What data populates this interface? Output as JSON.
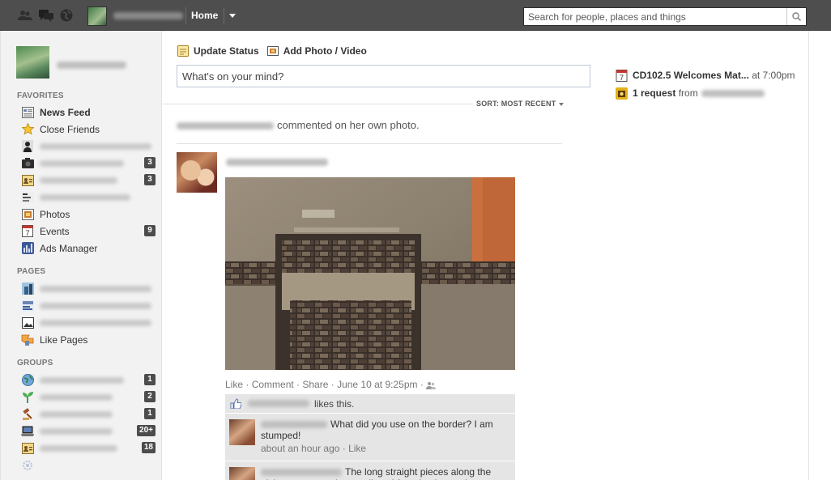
{
  "topbar": {
    "home_label": "Home",
    "search_placeholder": "Search for people, places and things",
    "icons": [
      "friend-requests-icon",
      "messages-icon",
      "notifications-globe-icon"
    ]
  },
  "sidebar": {
    "favorites_heading": "FAVORITES",
    "favorites": [
      {
        "label": "News Feed",
        "icon": "news-feed-icon",
        "bold": true
      },
      {
        "label": "Close Friends",
        "icon": "star-icon"
      },
      {
        "label": "",
        "icon": "person-photo-icon"
      },
      {
        "label": "",
        "icon": "camera-icon",
        "count": "3"
      },
      {
        "label": "",
        "icon": "contact-card-icon",
        "count": "3"
      },
      {
        "label": "",
        "icon": "page-thumb-icon"
      },
      {
        "label": "Photos",
        "icon": "photos-icon"
      },
      {
        "label": "Events",
        "icon": "calendar-icon",
        "count": "9"
      },
      {
        "label": "Ads Manager",
        "icon": "ads-manager-icon"
      }
    ],
    "pages_heading": "PAGES",
    "pages": [
      {
        "label": "",
        "icon": "page-building-icon"
      },
      {
        "label": "",
        "icon": "page-flag-icon"
      },
      {
        "label": "",
        "icon": "page-picture-icon"
      },
      {
        "label": "Like Pages",
        "icon": "like-pages-icon"
      }
    ],
    "groups_heading": "GROUPS",
    "groups": [
      {
        "label": "",
        "icon": "globe-icon",
        "count": "1"
      },
      {
        "label": "",
        "icon": "plant-icon",
        "count": "2"
      },
      {
        "label": "",
        "icon": "gavel-icon",
        "count": "1"
      },
      {
        "label": "",
        "icon": "laptop-icon",
        "count": "20+"
      },
      {
        "label": "",
        "icon": "group-card-icon",
        "count": "18"
      }
    ]
  },
  "composer": {
    "update_status": "Update Status",
    "add_photo": "Add Photo / Video",
    "placeholder": "What's on your mind?"
  },
  "feed": {
    "sort_label": "SORT: MOST RECENT",
    "story_text": "commented on her own photo.",
    "post": {
      "actions": {
        "like": "Like",
        "comment": "Comment",
        "share": "Share",
        "timestamp": "June 10 at 9:25pm"
      },
      "likes_text": "likes this.",
      "comments": [
        {
          "text": "What did you use on the border? I am stumped!",
          "time": "about an hour ago",
          "like": "Like"
        },
        {
          "text": "The long straight pieces along the niche are some glass outlines I found at home depot."
        }
      ]
    }
  },
  "right": {
    "event_title": "CD102.5 Welcomes Mat...",
    "event_time": "at 7:00pm",
    "request_text": "1 request",
    "request_from": "from"
  },
  "colors": {
    "topbar": "#4e4e4e",
    "sidebar_bg": "#f2f2f2",
    "badge": "#4c4c4c",
    "ufi_bg": "#e5e5e5"
  }
}
